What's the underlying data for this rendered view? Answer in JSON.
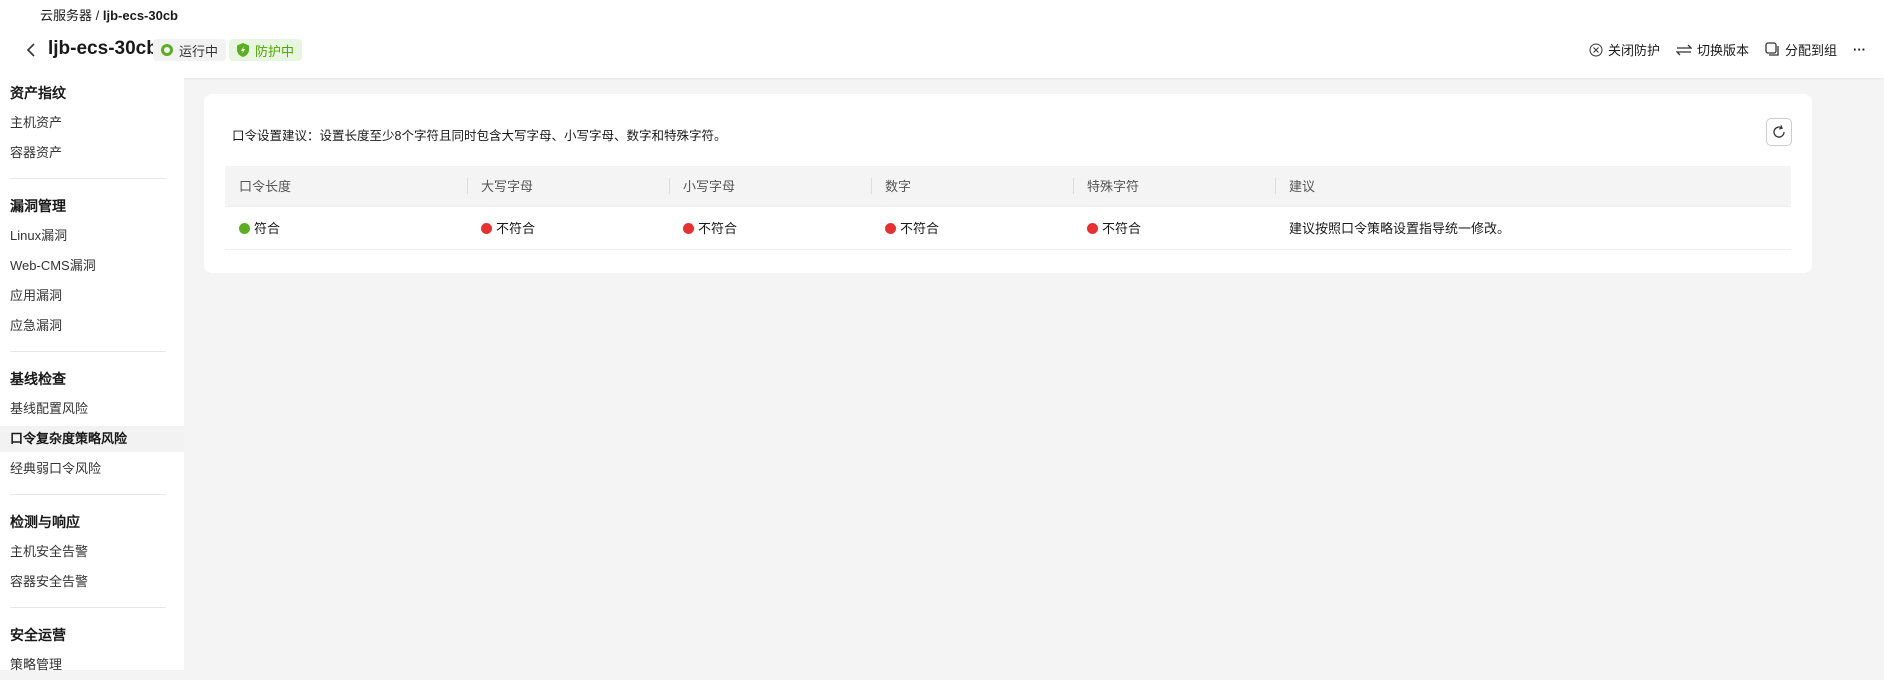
{
  "breadcrumb": {
    "parent": "云服务器",
    "current": "ljb-ecs-30cb"
  },
  "header": {
    "title": "ljb-ecs-30cb",
    "status_running": "运行中",
    "status_protect": "防护中",
    "actions": {
      "close": "关闭防护",
      "switch": "切换版本",
      "assign": "分配到组",
      "more": "···"
    }
  },
  "sidebar": {
    "groups": [
      {
        "label": "资产指纹",
        "items": [
          "主机资产",
          "容器资产"
        ]
      },
      {
        "label": "漏洞管理",
        "items": [
          "Linux漏洞",
          "Web-CMS漏洞",
          "应用漏洞",
          "应急漏洞"
        ]
      },
      {
        "label": "基线检查",
        "items": [
          "基线配置风险",
          "口令复杂度策略风险",
          "经典弱口令风险"
        ]
      },
      {
        "label": "检测与响应",
        "items": [
          "主机安全告警",
          "容器安全告警"
        ]
      },
      {
        "label": "安全运营",
        "items": [
          "策略管理"
        ]
      }
    ],
    "active": "口令复杂度策略风险"
  },
  "main": {
    "hint": "口令设置建议：设置长度至少8个字符且同时包含大写字母、小写字母、数字和特殊字符。",
    "columns": [
      "口令长度",
      "大写字母",
      "小写字母",
      "数字",
      "特殊字符",
      "建议"
    ],
    "row": [
      {
        "text": "符合",
        "status": "pass"
      },
      {
        "text": "不符合",
        "status": "fail"
      },
      {
        "text": "不符合",
        "status": "fail"
      },
      {
        "text": "不符合",
        "status": "fail"
      },
      {
        "text": "不符合",
        "status": "fail"
      },
      {
        "text": "建议按照口令策略设置指导统一修改。"
      }
    ]
  },
  "colors": {
    "pass": "#5aae1f",
    "fail": "#e93030",
    "accent": "#4fa800"
  }
}
